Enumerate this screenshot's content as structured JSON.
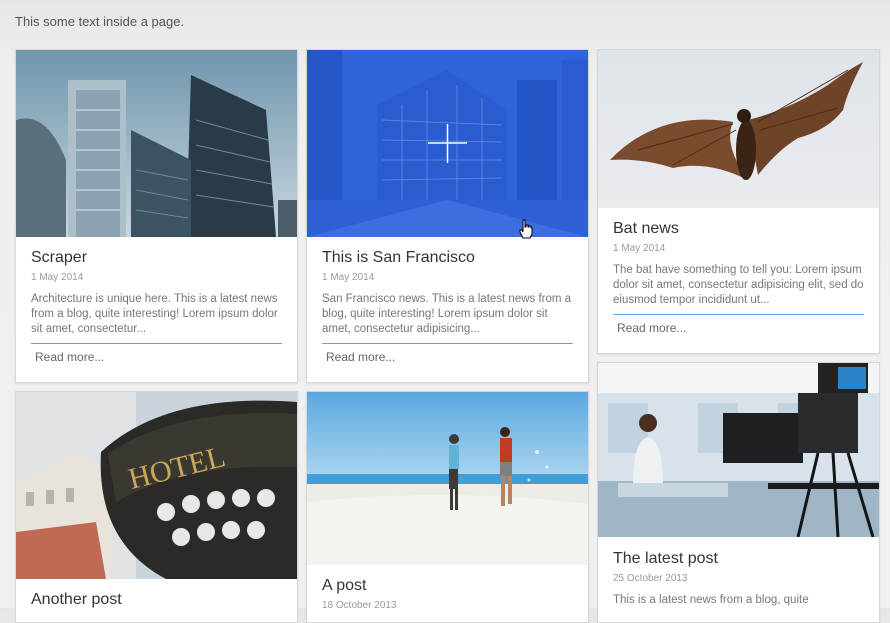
{
  "page": {
    "intro_text": "This some text inside a page."
  },
  "cards": [
    {
      "title": "Scraper",
      "date": "1 May 2014",
      "excerpt": "Architecture is unique here. This is a latest news from a blog, quite interesting! Lorem ipsum dolor sit amet, consectetur...",
      "read_more": "Read more...",
      "image": "skyscrapers-photo"
    },
    {
      "title": "This is San Francisco",
      "date": "1 May 2014",
      "excerpt": "San Francisco news. This is a latest news from a blog, quite interesting! Lorem ipsum dolor sit amet, consectetur adipisicing...",
      "read_more": "Read more...",
      "image": "san-francisco-photo",
      "hover_icon": "plus-icon"
    },
    {
      "title": "Bat news",
      "date": "1 May 2014",
      "excerpt": "The bat have something to tell you: Lorem ipsum dolor sit amet, consectetur adipisicing elit, sed do eiusmod tempor incididunt ut...",
      "read_more": "Read more...",
      "image": "bat-photo"
    },
    {
      "title": "Another post",
      "image": "hotel-sign-photo"
    },
    {
      "title": "A post",
      "date": "18 October 2013",
      "image": "beach-runners-photo"
    },
    {
      "title": "The latest post",
      "date": "25 October 2013",
      "excerpt": "This is a latest news from a blog, quite",
      "image": "news-studio-photo"
    }
  ],
  "colors": {
    "accent_rule": "#6f9ee0",
    "hover_overlay": "#1a56d6"
  }
}
